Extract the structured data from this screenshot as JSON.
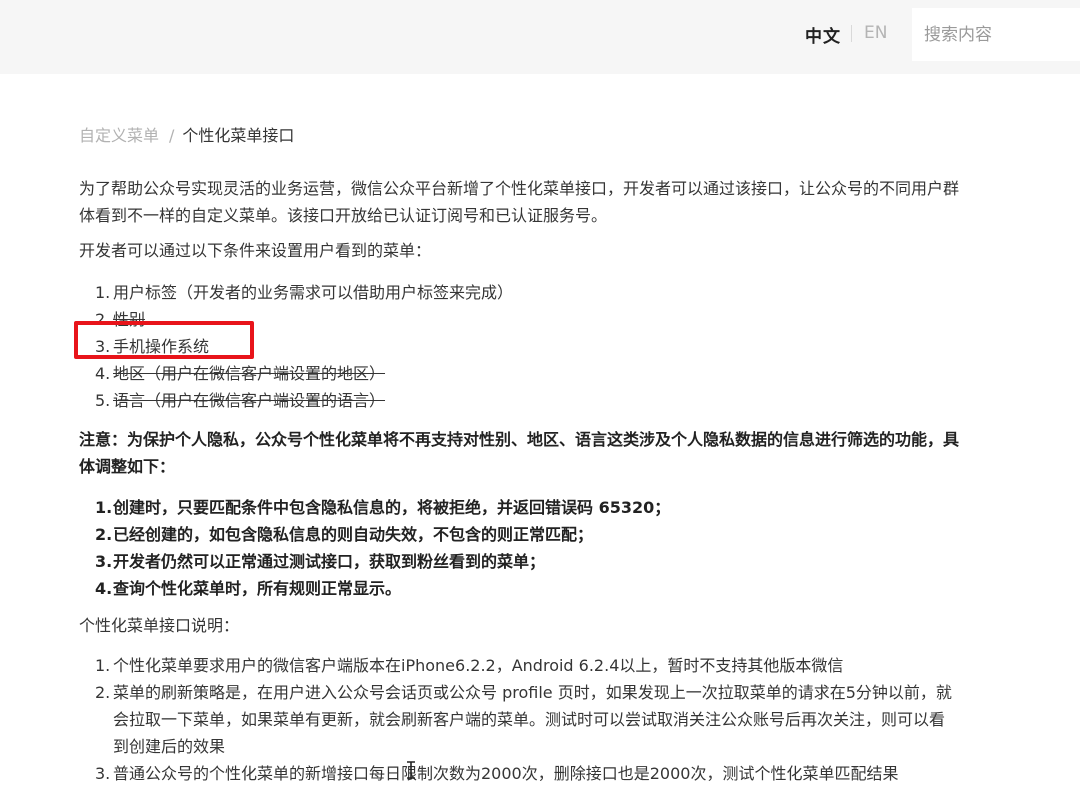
{
  "header": {
    "lang_zh": "中文",
    "lang_en": "EN",
    "search_placeholder": "搜索内容"
  },
  "breadcrumb": {
    "parent": "自定义菜单",
    "separator": "/",
    "current": "个性化菜单接口"
  },
  "intro": "为了帮助公众号实现灵活的业务运营，微信公众平台新增了个性化菜单接口，开发者可以通过该接口，让公众号的不同用户群体看到不一样的自定义菜单。该接口开放给已认证订阅号和已认证服务号。",
  "conditions_title": "开发者可以通过以下条件来设置用户看到的菜单：",
  "conditions": [
    {
      "num": "1.",
      "text": "用户标签（开发者的业务需求可以借助用户标签来完成）",
      "struck": false
    },
    {
      "num": "2.",
      "text": "性别",
      "struck": true
    },
    {
      "num": "3.",
      "text": "手机操作系统",
      "struck": false
    },
    {
      "num": "4.",
      "text": "地区（用户在微信客户端设置的地区）",
      "struck": true
    },
    {
      "num": "5.",
      "text": "语言（用户在微信客户端设置的语言）",
      "struck": true
    }
  ],
  "notice": "注意：为保护个人隐私，公众号个性化菜单将不再支持对性别、地区、语言这类涉及个人隐私数据的信息进行筛选的功能，具体调整如下：",
  "notice_items": [
    {
      "num": "1.",
      "text": "创建时，只要匹配条件中包含隐私信息的，将被拒绝，并返回错误码 65320；"
    },
    {
      "num": "2.",
      "text": "已经创建的，如包含隐私信息的则自动失效，不包含的则正常匹配；"
    },
    {
      "num": "3.",
      "text": "开发者仍然可以正常通过测试接口，获取到粉丝看到的菜单；"
    },
    {
      "num": "4.",
      "text": "查询个性化菜单时，所有规则正常显示。"
    }
  ],
  "desc_title": "个性化菜单接口说明：",
  "desc_items": [
    {
      "num": "1.",
      "text": "个性化菜单要求用户的微信客户端版本在iPhone6.2.2，Android 6.2.4以上，暂时不支持其他版本微信"
    },
    {
      "num": "2.",
      "text": "菜单的刷新策略是，在用户进入公众号会话页或公众号 profile 页时，如果发现上一次拉取菜单的请求在5分钟以前，就会拉取一下菜单，如果菜单有更新，就会刷新客户端的菜单。测试时可以尝试取消关注公众账号后再次关注，则可以看到创建后的效果"
    },
    {
      "num": "3.",
      "text": "普通公众号的个性化菜单的新增接口每日限制次数为2000次，删除接口也是2000次，测试个性化菜单匹配结果"
    }
  ],
  "colors": {
    "highlight": "#e8141a",
    "topbar": "#f6f6f6"
  }
}
